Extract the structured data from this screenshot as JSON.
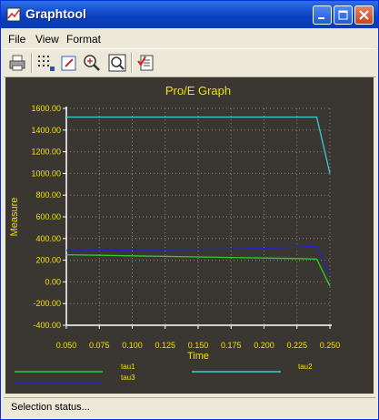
{
  "window": {
    "title": "Graphtool"
  },
  "menu": [
    "File",
    "View",
    "Format"
  ],
  "toolbar": {
    "icons": [
      "print-icon",
      "grid-icon",
      "edit-icon",
      "zoom-in-icon",
      "zoom-fit-icon",
      "list-check-icon"
    ]
  },
  "status": {
    "text": "Selection status..."
  },
  "colors": {
    "plot_bg": "#3a3732",
    "title_color": "#f0e000",
    "tau1": "#2fcc2f",
    "tau2": "#33d0d0",
    "tau3": "#2323c8"
  },
  "chart_data": {
    "type": "line",
    "title": "Pro/E Graph",
    "xlabel": "Time",
    "ylabel": "Measure",
    "xlim": [
      0.05,
      0.25
    ],
    "ylim": [
      -400,
      1600
    ],
    "grid": true,
    "legend_position": "bottom",
    "xticks": [
      "0.050",
      "0.075",
      "0.100",
      "0.125",
      "0.150",
      "0.175",
      "0.200",
      "0.225",
      "0.250"
    ],
    "yticks": [
      "-400.00",
      "-200.00",
      "0.00",
      "200.00",
      "400.00",
      "600.00",
      "800.00",
      "1000.00",
      "1200.00",
      "1400.00",
      "1600.00"
    ],
    "series": [
      {
        "name": "tau1",
        "x": [
          0.05,
          0.075,
          0.1,
          0.15,
          0.2,
          0.225,
          0.24,
          0.25
        ],
        "y": [
          250,
          245,
          240,
          230,
          220,
          215,
          210,
          -40
        ]
      },
      {
        "name": "tau2",
        "x": [
          0.05,
          0.1,
          0.15,
          0.2,
          0.24,
          0.25
        ],
        "y": [
          1520,
          1520,
          1520,
          1520,
          1520,
          1000
        ]
      },
      {
        "name": "tau3",
        "x": [
          0.05,
          0.1,
          0.15,
          0.2,
          0.225,
          0.24,
          0.25
        ],
        "y": [
          290,
          295,
          300,
          310,
          320,
          330,
          70
        ]
      }
    ]
  }
}
